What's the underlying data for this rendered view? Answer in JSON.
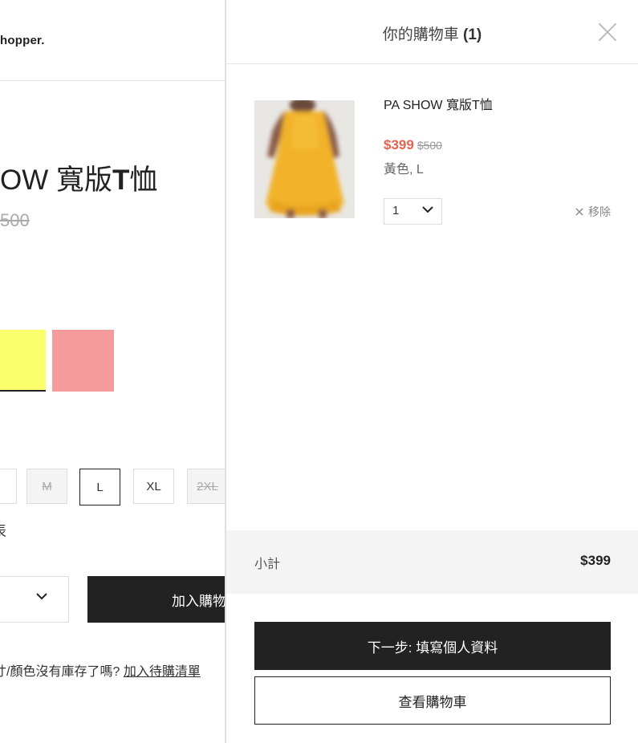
{
  "background_page": {
    "logo_text": "hopper.",
    "product_title_prefix": "OW 寬版",
    "product_title_bold": "T",
    "product_title_suffix": "恤",
    "original_price": "500",
    "sizes": [
      {
        "label": "M",
        "state": "disabled"
      },
      {
        "label": "L",
        "state": "selected"
      },
      {
        "label": "XL",
        "state": "normal"
      },
      {
        "label": "2XL",
        "state": "disabled"
      }
    ],
    "size_chart_fragment": "表",
    "add_to_cart_label": "加入購物",
    "waitlist_prompt": "寸/顏色沒有庫存了嗎?",
    "waitlist_link": "加入待購清單",
    "colors": {
      "swatch_yellow": "#fbff6b",
      "swatch_pink": "#f59b9b"
    }
  },
  "drawer": {
    "title": "你的購物車",
    "count": "(1)",
    "items": [
      {
        "name": "PA SHOW 寬版T恤",
        "price_now": "$399",
        "price_was": "$500",
        "variant": "黃色, L",
        "quantity": "1",
        "remove_label": "移除"
      }
    ],
    "subtotal_label": "小計",
    "subtotal_value": "$399",
    "next_button": "下一步: 填寫個人資料",
    "view_cart_button": "查看購物車"
  }
}
